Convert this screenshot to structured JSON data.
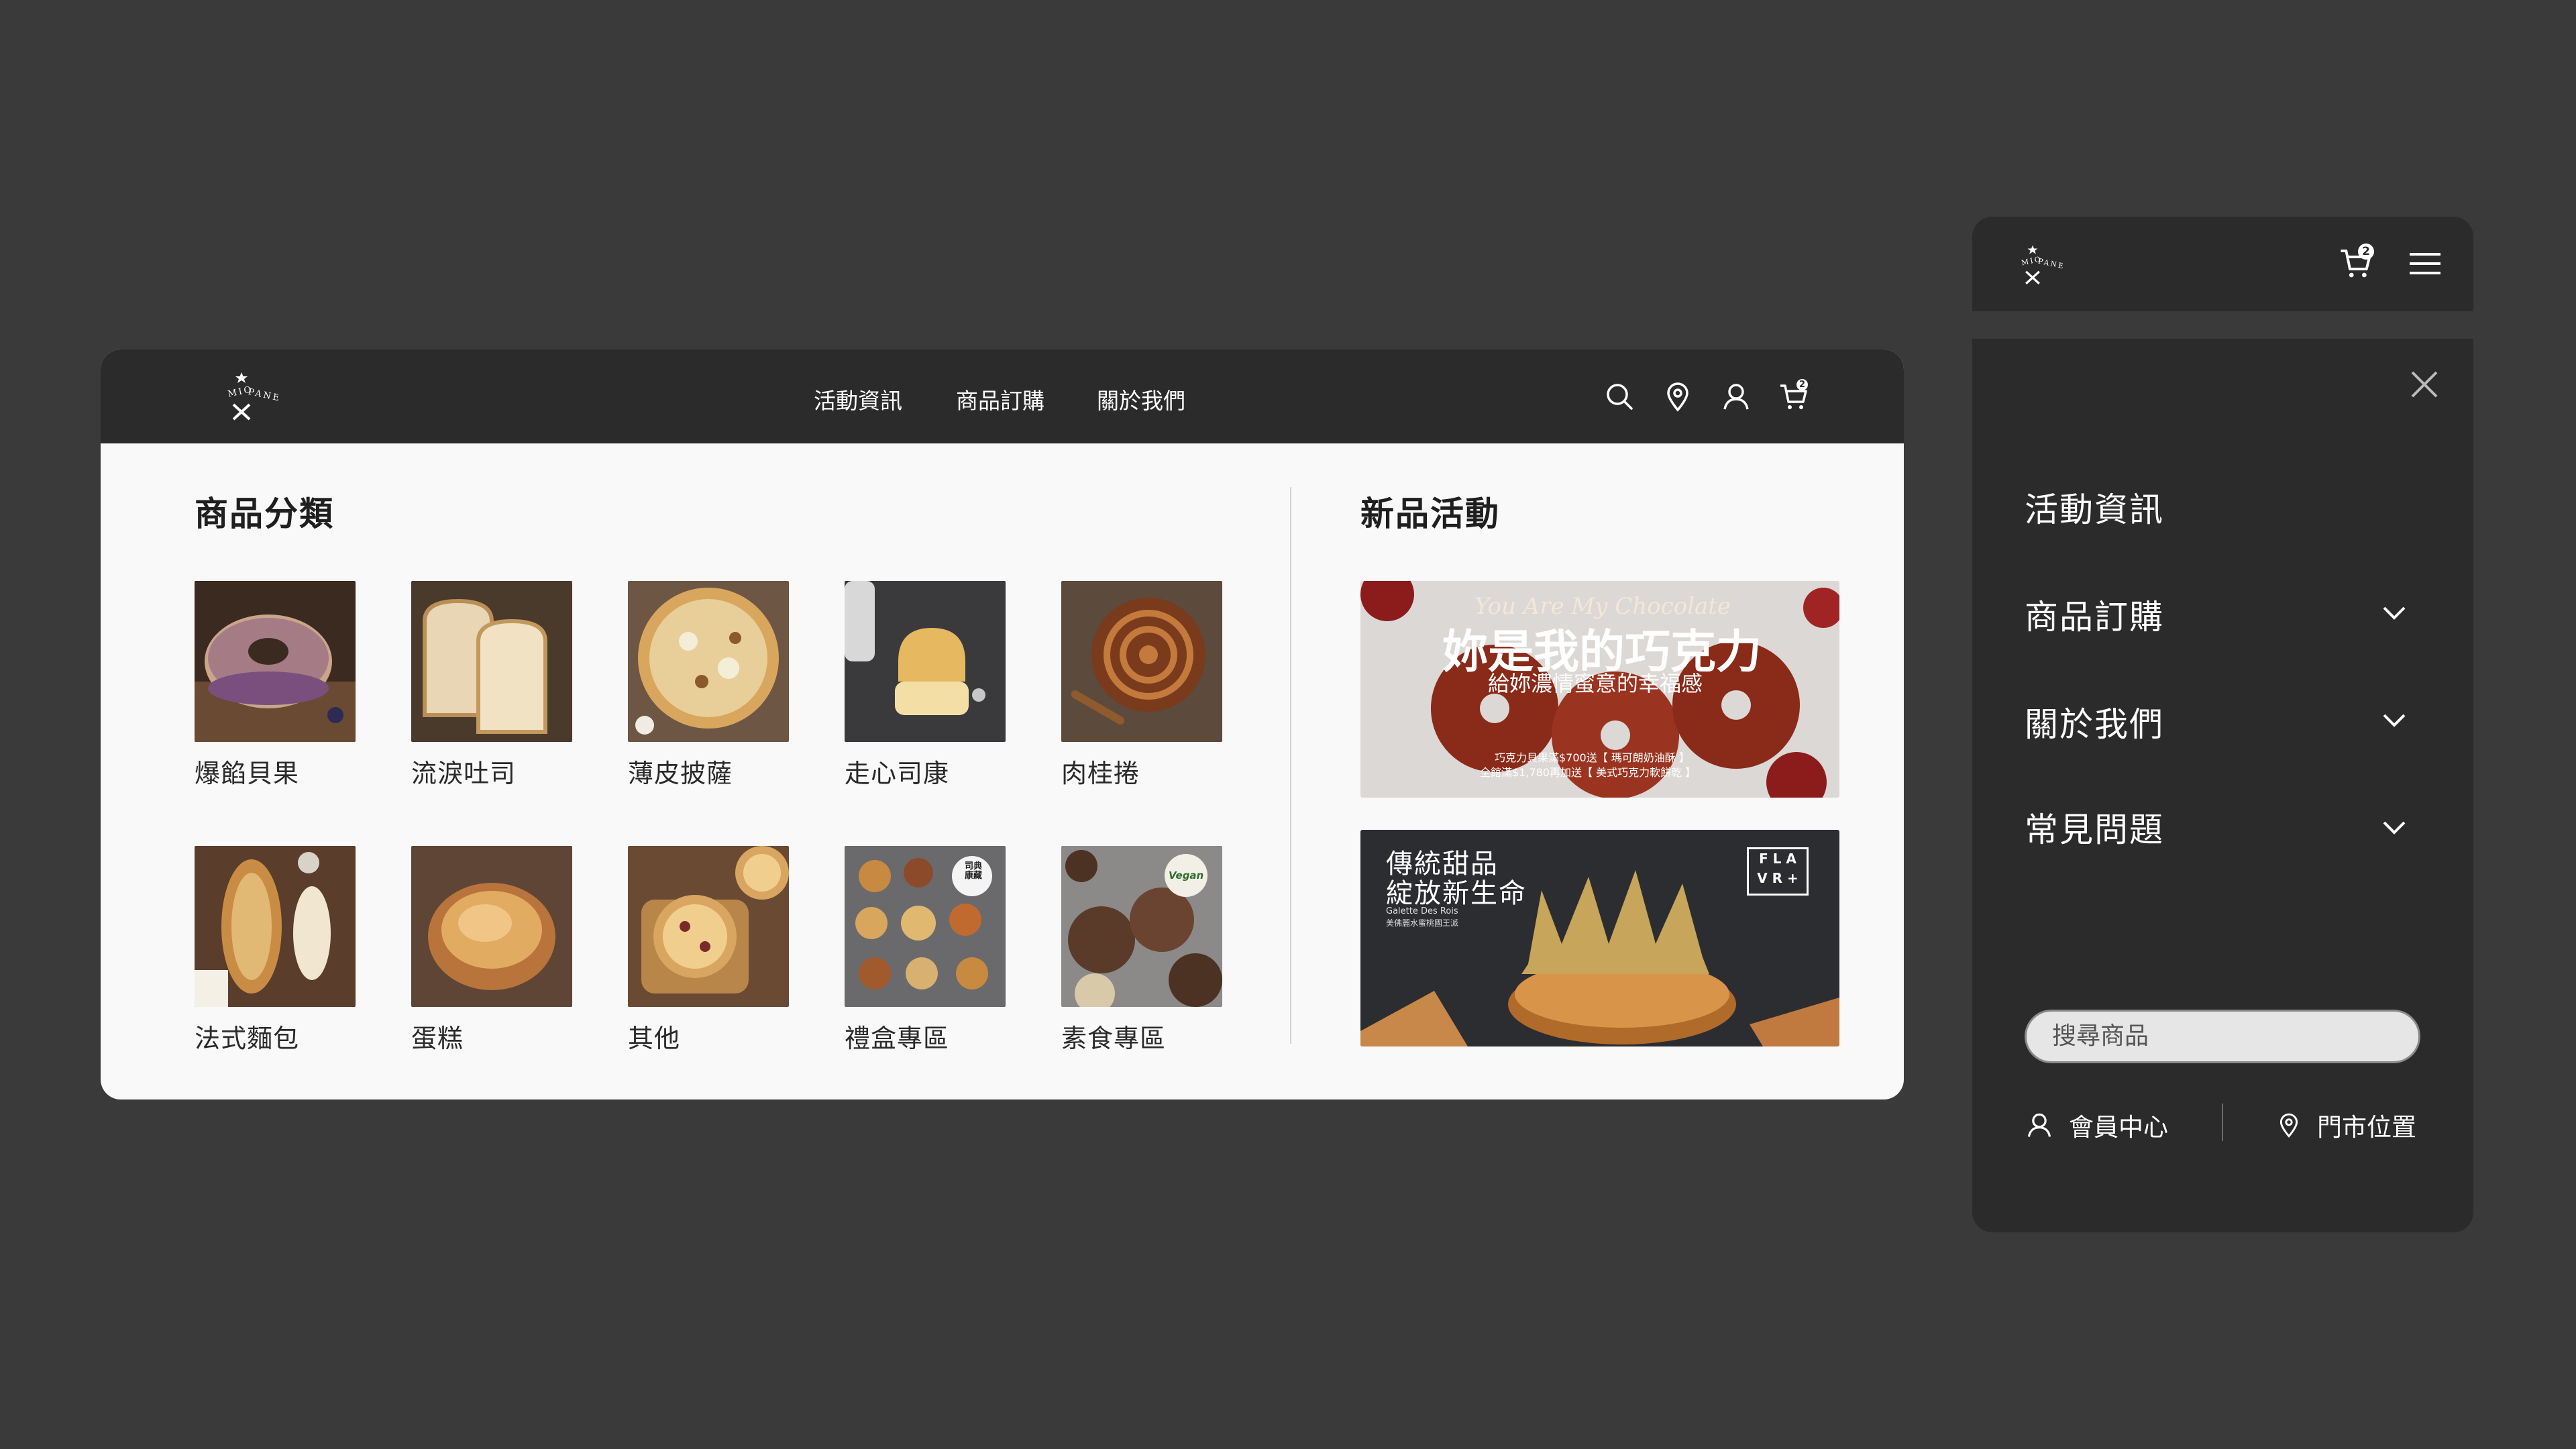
{
  "brand": {
    "name": "MIOPANE"
  },
  "desktop": {
    "nav": [
      "活動資訊",
      "商品訂購",
      "關於我們"
    ],
    "cart_count": "2",
    "categories_title": "商品分類",
    "categories": [
      {
        "label": "爆餡貝果"
      },
      {
        "label": "流淚吐司"
      },
      {
        "label": "薄皮披薩"
      },
      {
        "label": "走心司康"
      },
      {
        "label": "肉桂捲"
      },
      {
        "label": "法式麵包"
      },
      {
        "label": "蛋糕"
      },
      {
        "label": "其他"
      },
      {
        "label": "禮盒專區"
      },
      {
        "label": "素食專區"
      }
    ],
    "gift_badge": "司典\n康藏",
    "vegan_badge": "Vegan",
    "promos_title": "新品活動",
    "promo1": {
      "script": "You Are My Chocolate",
      "headline": "妳是我的巧克力",
      "sub": "給妳濃情蜜意的幸福感",
      "fine1": "巧克力貝果滿$700送【 瑪可朗奶油酥 】",
      "fine2": "全館滿$1,780再加送【 美式巧克力軟餅乾 】"
    },
    "promo2": {
      "line1": "傳統甜品",
      "line2": "綻放新生命",
      "latin": "Galette Des Rois",
      "cn_small": "美佛麗水蜜桃國王派",
      "badge_top": "F L A",
      "badge_bottom": "V R +"
    }
  },
  "mobile": {
    "cart_count": "2",
    "menu": [
      {
        "label": "活動資訊",
        "has_chevron": false
      },
      {
        "label": "商品訂購",
        "has_chevron": true
      },
      {
        "label": "關於我們",
        "has_chevron": true
      },
      {
        "label": "常見問題",
        "has_chevron": true
      }
    ],
    "search_placeholder": "搜尋商品",
    "member_center": "會員中心",
    "store_location": "門市位置"
  },
  "icons": {
    "search": "search-icon",
    "location": "location-pin-icon",
    "user": "user-icon",
    "cart": "cart-icon",
    "menu": "hamburger-menu-icon",
    "close": "close-icon",
    "chevron": "chevron-down-icon"
  },
  "colors": {
    "background": "#3a3a3a",
    "header": "#2b2b2b",
    "panel": "#f9f9f9"
  }
}
